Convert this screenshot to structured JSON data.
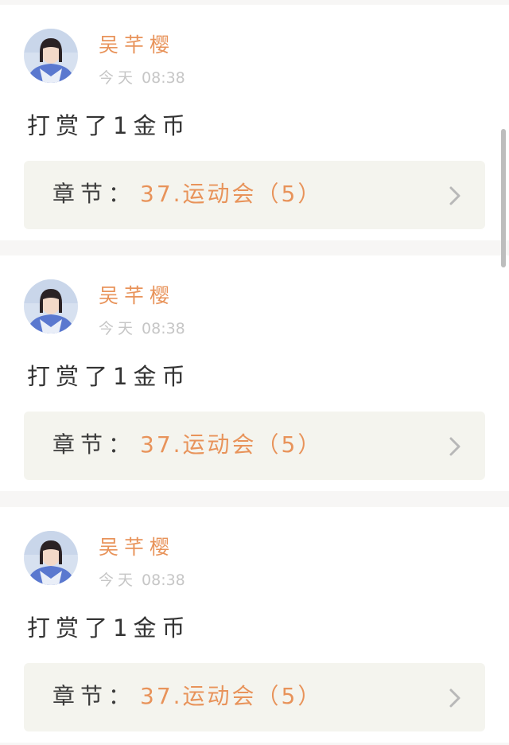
{
  "colors": {
    "accent": "#e8935a",
    "text_dark": "#333333",
    "text_muted": "#c6c6c6",
    "chapter_bg": "#f4f4ee",
    "page_bg": "#f7f6f5"
  },
  "icons": {
    "avatar": "user-avatar-photo",
    "chevron": "chevron-right-icon"
  },
  "feed": {
    "items": [
      {
        "username": "吴芊樱",
        "time_day": "今天",
        "time_clock": "08:38",
        "message": "打赏了1金币",
        "chapter_prefix": "章节：",
        "chapter_name": "37.运动会（5）"
      },
      {
        "username": "吴芊樱",
        "time_day": "今天",
        "time_clock": "08:38",
        "message": "打赏了1金币",
        "chapter_prefix": "章节：",
        "chapter_name": "37.运动会（5）"
      },
      {
        "username": "吴芊樱",
        "time_day": "今天",
        "time_clock": "08:38",
        "message": "打赏了1金币",
        "chapter_prefix": "章节：",
        "chapter_name": "37.运动会（5）"
      }
    ]
  }
}
